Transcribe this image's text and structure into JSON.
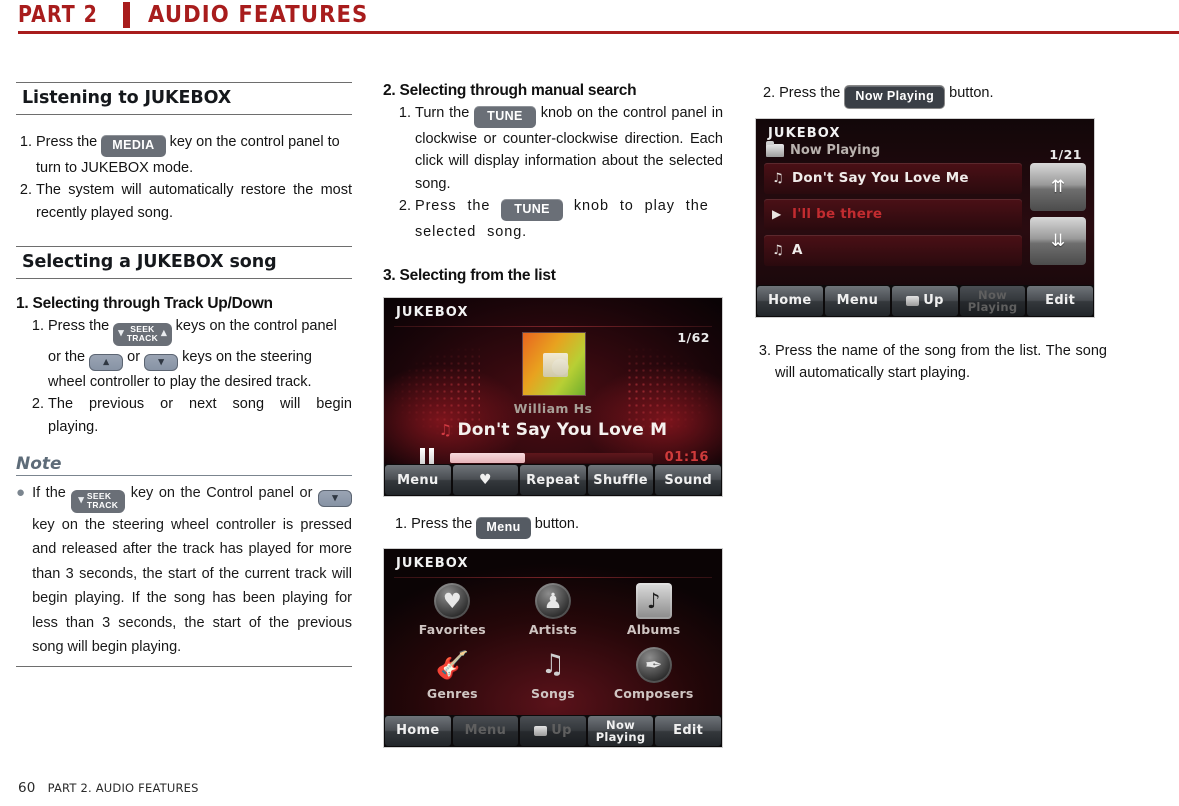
{
  "header": {
    "part": "PART 2",
    "title": "AUDIO FEATURES",
    "accent_color": "#a81c1c"
  },
  "footer": {
    "page_number": "60",
    "section": "PART 2. AUDIO FEATURES"
  },
  "column_1": {
    "section_1_heading": "Listening to JUKEBOX",
    "steps_1": [
      {
        "num": "1.",
        "text_before": "Press the",
        "key": "MEDIA",
        "text_after": "key on the control panel to turn to JUKEBOX mode."
      },
      {
        "num": "2.",
        "text_before": "",
        "key": "",
        "text_after": "The system will automatically restore the most recently played song."
      }
    ],
    "section_2_heading": "Selecting a JUKEBOX song",
    "sub_1_heading": "1. Selecting through Track Up/Down",
    "sub_1_step_1_a": "Press the",
    "sub_1_step_1_b": "keys on the control panel or the",
    "sub_1_step_1_c": "or",
    "sub_1_step_1_d": "keys on the steering wheel controller to play the desired track.",
    "sub_1_step_2": "The previous or next song will begin playing.",
    "seek_key_line1": "SEEK",
    "seek_key_line2": "TRACK",
    "note_title": "Note",
    "note_a": "If the",
    "note_b": "key on the Control panel or",
    "note_c": "key on the steering wheel controller is pressed and released after the track has played for more than 3 seconds, the start of the current track will begin playing. If the song has been playing for less than 3 seconds, the start of the previous song will begin playing."
  },
  "column_2": {
    "sub_2_heading": "2. Selecting through manual search",
    "sub_2_step_1_a": "Turn the",
    "sub_2_step_1_key": "TUNE",
    "sub_2_step_1_b": "knob on the control panel in clockwise or counter-clockwise direction. Each click will display information about the selected song.",
    "sub_2_step_2_a": "Press the",
    "sub_2_step_2_key": "TUNE",
    "sub_2_step_2_b": "knob to play the selected song.",
    "sub_3_heading": "3. Selecting from the list",
    "step_menu_num": "1.",
    "step_menu_a": "Press the",
    "step_menu_key": "Menu",
    "step_menu_b": "button."
  },
  "column_3": {
    "step_np_num": "2.",
    "step_np_a": "Press the",
    "step_np_key": "Now Playing",
    "step_np_b": "button.",
    "step_3_num": "3.",
    "step_3_text": "Press the name of the song from the list. The song will automatically start playing."
  },
  "player_screen": {
    "title": "JUKEBOX",
    "counter": "1/62",
    "artist": "William Hs",
    "track": "Don't Say You Love M",
    "note_glyph": "♫",
    "elapsed": "01:16",
    "progress_percent": 37,
    "buttons": [
      {
        "label": "Menu",
        "type": "text"
      },
      {
        "label": "♥",
        "type": "icon"
      },
      {
        "label": "Repeat",
        "type": "text"
      },
      {
        "label": "Shuffle",
        "type": "text"
      },
      {
        "label": "Sound",
        "type": "text"
      }
    ]
  },
  "menu_screen": {
    "title": "JUKEBOX",
    "items": [
      {
        "label": "Favorites",
        "icon": "heart-icon",
        "glyph": "♥"
      },
      {
        "label": "Artists",
        "icon": "person-icon",
        "glyph": "♟"
      },
      {
        "label": "Albums",
        "icon": "note-square-icon",
        "glyph": "♪"
      },
      {
        "label": "Genres",
        "icon": "guitar-icon",
        "glyph": "𝄞"
      },
      {
        "label": "Songs",
        "icon": "music-note-icon",
        "glyph": "♫"
      },
      {
        "label": "Composers",
        "icon": "pen-icon",
        "glyph": "✒"
      }
    ],
    "buttons": [
      {
        "label": "Home",
        "state": "active"
      },
      {
        "label": "Menu",
        "state": "dim"
      },
      {
        "label": "Up",
        "state": "dim",
        "icon": "folder-up-icon"
      },
      {
        "label": "Now Playing",
        "state": "active"
      },
      {
        "label": "Edit",
        "state": "active"
      }
    ]
  },
  "list_screen": {
    "title": "JUKEBOX",
    "subtitle": "Now Playing",
    "folder_icon": "folder-icon",
    "counter": "1/21",
    "rows": [
      {
        "label": "Don't Say You Love Me",
        "glyph": "♫",
        "state": "normal"
      },
      {
        "label": "I'll be there",
        "glyph": "▶",
        "state": "playing"
      },
      {
        "label": "A",
        "glyph": "♫",
        "state": "normal"
      }
    ],
    "scroll_up": "⇈",
    "scroll_down": "⇊",
    "buttons": [
      {
        "label": "Home",
        "state": "active"
      },
      {
        "label": "Menu",
        "state": "active"
      },
      {
        "label": "Up",
        "state": "active",
        "icon": "folder-up-icon"
      },
      {
        "label": "Now Playing",
        "state": "dim"
      },
      {
        "label": "Edit",
        "state": "active"
      }
    ]
  }
}
